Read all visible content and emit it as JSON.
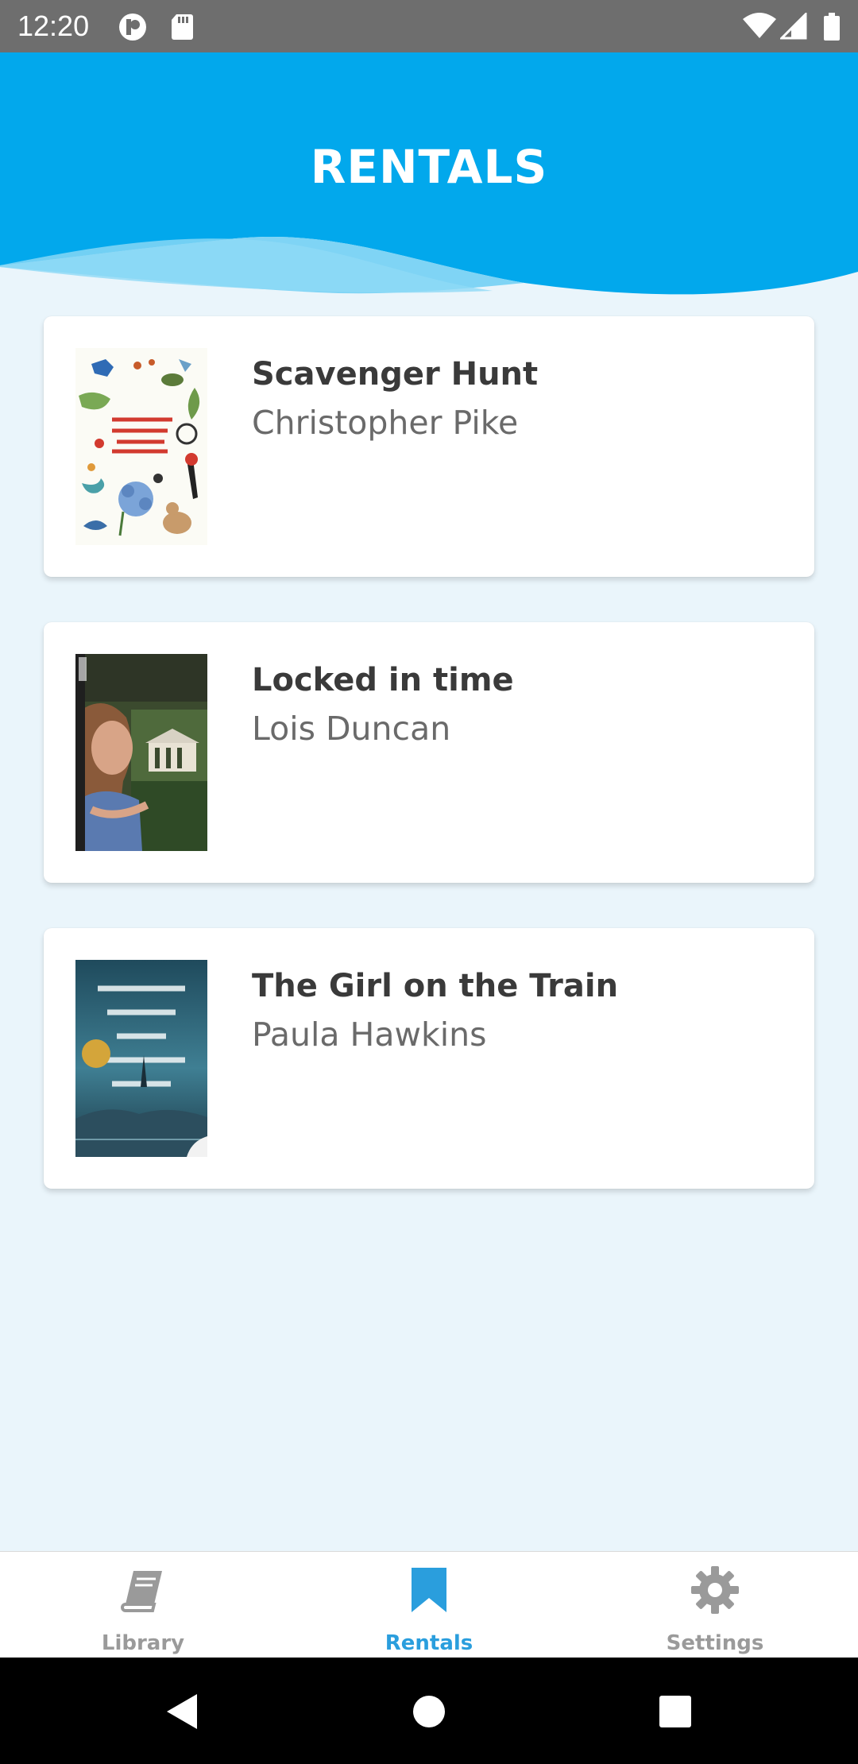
{
  "status_bar": {
    "time": "12:20"
  },
  "header": {
    "title": "RENTALS",
    "color": "#02a8ec"
  },
  "rentals": [
    {
      "title": "Scavenger Hunt",
      "author": "Christopher Pike"
    },
    {
      "title": "Locked in time",
      "author": "Lois Duncan"
    },
    {
      "title": "The Girl on the Train",
      "author": "Paula Hawkins"
    }
  ],
  "tabs": [
    {
      "label": "Library",
      "icon": "book-icon",
      "active": false
    },
    {
      "label": "Rentals",
      "icon": "bookmark-icon",
      "active": true
    },
    {
      "label": "Settings",
      "icon": "gear-icon",
      "active": false
    }
  ],
  "colors": {
    "accent": "#2a9edd",
    "background": "#eaf5fb"
  }
}
